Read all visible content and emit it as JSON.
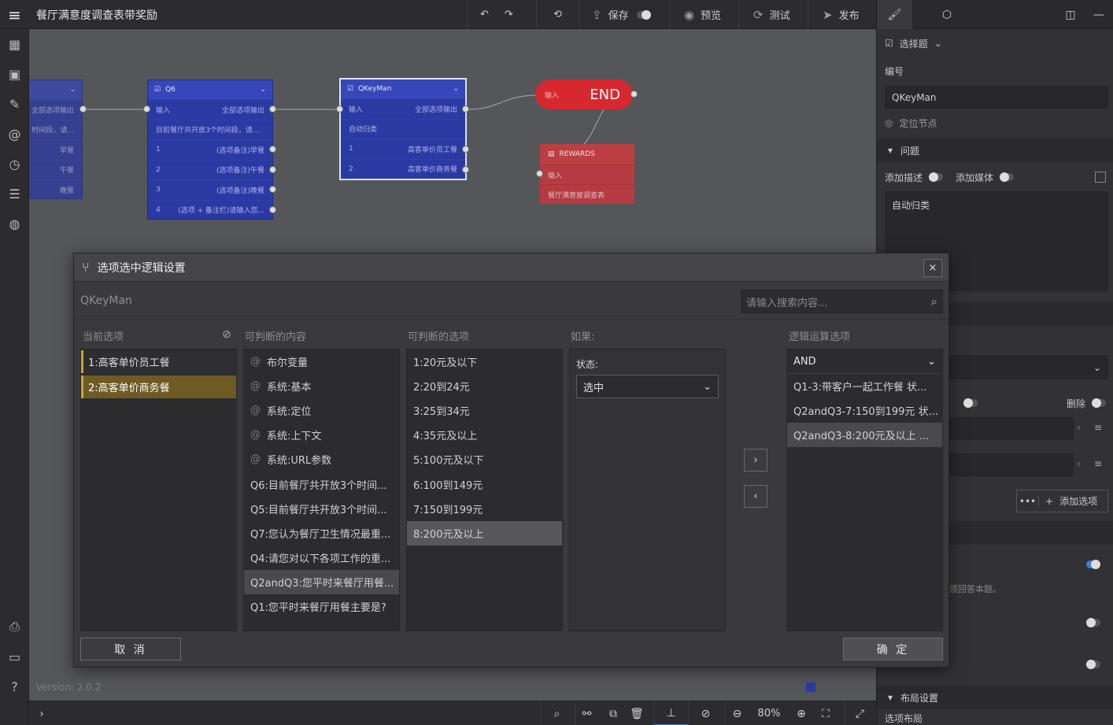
{
  "app": {
    "title": "餐厅满意度调查表带奖励",
    "version": "Version: 2.0.2"
  },
  "toolbar": {
    "save": "保存",
    "preview": "预览",
    "test": "测试",
    "publish": "发布"
  },
  "canvas": {
    "zoom": "80%",
    "partial_node": {
      "rows": [
        "全部选项输出",
        "时间段，请...",
        "早餐",
        "午餐",
        "晚餐"
      ]
    },
    "q6_node": {
      "title": "Q6",
      "input": "输入",
      "all_output": "全部选项输出",
      "desc": "目前餐厅共开放3个时间段，请...",
      "rows": [
        {
          "num": "1",
          "label": "(选项备注)早餐"
        },
        {
          "num": "2",
          "label": "(选项备注)午餐"
        },
        {
          "num": "3",
          "label": "(选项备注)晚餐"
        },
        {
          "num": "4",
          "label": "(选项 + 备注栏)请输入您..."
        }
      ]
    },
    "qkeyman_node": {
      "title": "QKeyMan",
      "input": "输入",
      "all_output": "全部选项输出",
      "desc": "自动归类",
      "rows": [
        {
          "num": "1",
          "label": "高客单价员工餐"
        },
        {
          "num": "2",
          "label": "高客单价商务餐"
        }
      ]
    },
    "end_node": {
      "input": "输入",
      "label": "END"
    },
    "rewards_node": {
      "title": "REWARDS",
      "input": "输入",
      "desc": "餐厅满意度调查表"
    }
  },
  "right_panel": {
    "type_label": "选择题",
    "id_label": "编号",
    "id_value": "QKeyMan",
    "locate_node": "定位节点",
    "question_section": "问题",
    "add_desc": "添加描述",
    "add_media": "添加媒体",
    "question_text": "自动归类",
    "delete_label": "删除",
    "add_option": "添加选项",
    "must_answer_hint": "须回答本题。",
    "layout_section": "布局设置",
    "option_layout": "选项布局"
  },
  "modal": {
    "title": "选项选中逻辑设置",
    "question_name": "QKeyMan",
    "search_placeholder": "请输入搜索内容...",
    "col_current": "当前选项",
    "col_content": "可判断的内容",
    "col_options": "可判断的选项",
    "col_if": "如果:",
    "col_logic": "逻辑运算选项",
    "current_options": [
      {
        "label": "1:高客单价员工餐"
      },
      {
        "label": "2:高客单价商务餐"
      }
    ],
    "content_items": [
      {
        "label": "布尔变量",
        "system": true
      },
      {
        "label": "系统:基本",
        "system": true
      },
      {
        "label": "系统:定位",
        "system": true
      },
      {
        "label": "系统:上下文",
        "system": true
      },
      {
        "label": "系统:URL参数",
        "system": true
      },
      {
        "label": "Q6:目前餐厅共开放3个时间..."
      },
      {
        "label": "Q5:目前餐厅共开放3个时间..."
      },
      {
        "label": "Q7:您认为餐厅卫生情况最重..."
      },
      {
        "label": "Q4:请您对以下各项工作的重..."
      },
      {
        "label": "Q2andQ3:您平时来餐厅用餐..."
      },
      {
        "label": "Q1:您平时来餐厅用餐主要是?"
      }
    ],
    "option_items": [
      "1:20元及以下",
      "2:20到24元",
      "3:25到34元",
      "4:35元及以上",
      "5:100元及以下",
      "6:100到149元",
      "7:150到199元",
      "8:200元及以上"
    ],
    "status_label": "状态:",
    "status_value": "选中",
    "logic_operator": "AND",
    "logic_items": [
      "Q1-3:带客户一起工作餐 状...",
      "Q2andQ3-7:150到199元 状...",
      "Q2andQ3-8:200元及以上 ..."
    ],
    "cancel": "取 消",
    "confirm": "确 定"
  },
  "colors": {
    "node_blue": "#2b3aa3",
    "end_red": "#d8282f",
    "selection_gold": "#6e5a23"
  }
}
